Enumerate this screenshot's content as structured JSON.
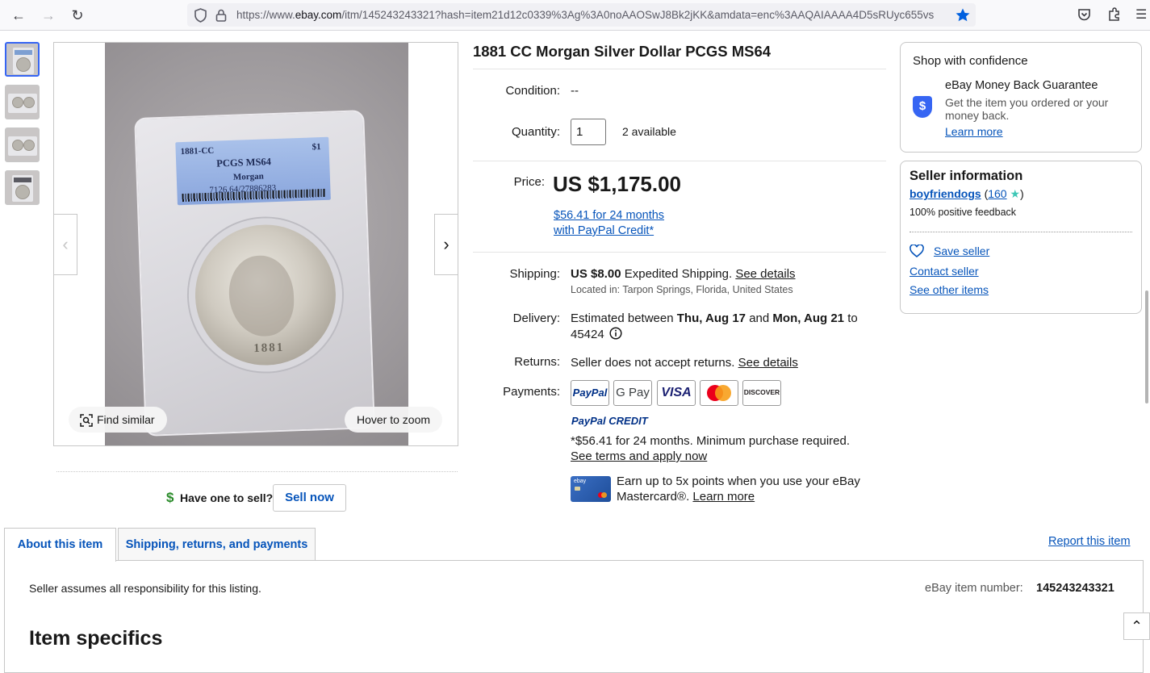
{
  "browser": {
    "url_prefix": "https://www.",
    "url_host": "ebay.com",
    "url_rest": "/itm/145243243321?hash=item21d12c0339%3Ag%3A0noAAOSwJ8Bk2jKK&amdata=enc%3AAQAIAAAA4D5sRUyc655vs"
  },
  "gallery": {
    "thumbnail_count": 4,
    "label_year": "1881-CC",
    "label_denom": "$1",
    "label_grade": "PCGS MS64",
    "label_variety": "Morgan",
    "label_cert": "7126.64/27886283",
    "coin_date": "1881",
    "find_similar": "Find similar",
    "hover_zoom": "Hover to zoom"
  },
  "sell": {
    "prompt": "Have one to sell?",
    "button": "Sell now"
  },
  "item": {
    "title": "1881 CC Morgan Silver Dollar PCGS MS64",
    "condition_label": "Condition:",
    "condition_value": "--",
    "quantity_label": "Quantity:",
    "quantity_value": "1",
    "available": "2 available",
    "price_label": "Price:",
    "price": "US $1,175.00",
    "paypal_line1": "$56.41 for 24 months",
    "paypal_line2": "with PayPal Credit*",
    "shipping_label": "Shipping:",
    "shipping_cost": "US $8.00",
    "shipping_method": "Expedited Shipping.",
    "shipping_details": "See details",
    "located": "Located in: Tarpon Springs, Florida, United States",
    "delivery_label": "Delivery:",
    "delivery_prefix": "Estimated between",
    "delivery_from": "Thu, Aug 17",
    "delivery_and": "and",
    "delivery_to": "Mon, Aug 21",
    "delivery_to_word": "to",
    "delivery_zip": "45424",
    "returns_label": "Returns:",
    "returns_text": "Seller does not accept returns.",
    "returns_details": "See details",
    "payments_label": "Payments:",
    "pay_paypal": "PayPal",
    "pay_gpay": "G Pay",
    "pay_visa": "VISA",
    "pay_discover": "DISCOVER",
    "paypal_credit": "PayPal CREDIT",
    "credit_terms": "*$56.41 for 24 months. Minimum purchase required.",
    "credit_link": "See terms and apply now",
    "card_ebay_label": "ebay",
    "mastercard_line1": "Earn up to 5x points when you use your eBay",
    "mastercard_line2": "Mastercard®.",
    "mastercard_link": "Learn more"
  },
  "confidence": {
    "heading": "Shop with confidence",
    "guarantee_title": "eBay Money Back Guarantee",
    "guarantee_line1": "Get the item you ordered or your",
    "guarantee_line2": "money back.",
    "learn_more": "Learn more",
    "shield_glyph": "$"
  },
  "seller": {
    "heading": "Seller information",
    "name": "boyfriendogs",
    "open_paren": "(",
    "score": "160",
    "close_paren": ")",
    "feedback": "100% positive feedback",
    "save_seller": "Save seller",
    "contact_seller": "Contact seller",
    "other_items": "See other items"
  },
  "tabs": {
    "about": "About this item",
    "shipping": "Shipping, returns, and payments",
    "report": "Report this item",
    "responsibility": "Seller assumes all responsibility for this listing.",
    "item_number_label": "eBay item number:",
    "item_number": "145243243321",
    "specifics_heading": "Item specifics"
  },
  "colors": {
    "link": "#0654ba",
    "accent": "#3665f3",
    "star": "#3ec7b6"
  }
}
